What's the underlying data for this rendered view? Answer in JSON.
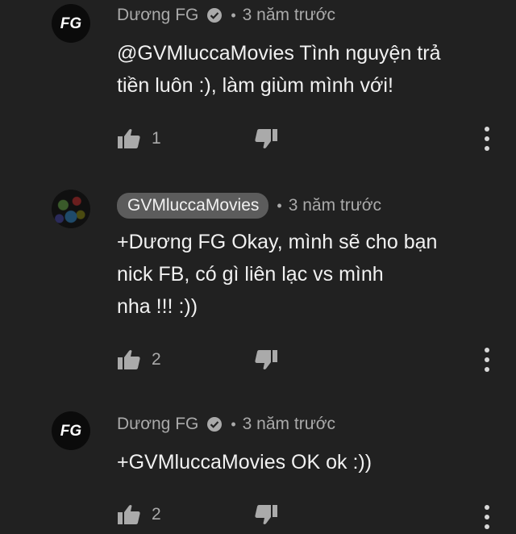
{
  "comments": [
    {
      "author": "Dương FG",
      "verified": true,
      "time": "3 năm trước",
      "text_lines": [
        "@GVMluccaMovies Tình nguyện trả",
        "tiền luôn :), làm giùm mình với!"
      ],
      "likes": "1",
      "avatar": "FG"
    },
    {
      "author": "GVMluccaMovies",
      "verified": false,
      "time": "3 năm trước",
      "text_lines": [
        "+Dương FG Okay, mình sẽ cho bạn",
        "nick FB, có gì liên lạc vs mình",
        "nha !!! :))"
      ],
      "likes": "2"
    },
    {
      "author": "Dương FG",
      "verified": true,
      "time": "3 năm trước",
      "text_lines": [
        "+GVMluccaMovies OK ok :))"
      ],
      "likes": "2",
      "avatar": "FG"
    }
  ],
  "separator": "•",
  "icons": {
    "like": "thumbs-up-icon",
    "dislike": "thumbs-down-icon",
    "more": "more-vertical-icon",
    "verified": "verified-check-icon"
  },
  "colors": {
    "background": "#212121",
    "text_primary": "#f1f1f1",
    "text_secondary": "#aaaaaa",
    "author_chip": "#5c5c5c"
  }
}
